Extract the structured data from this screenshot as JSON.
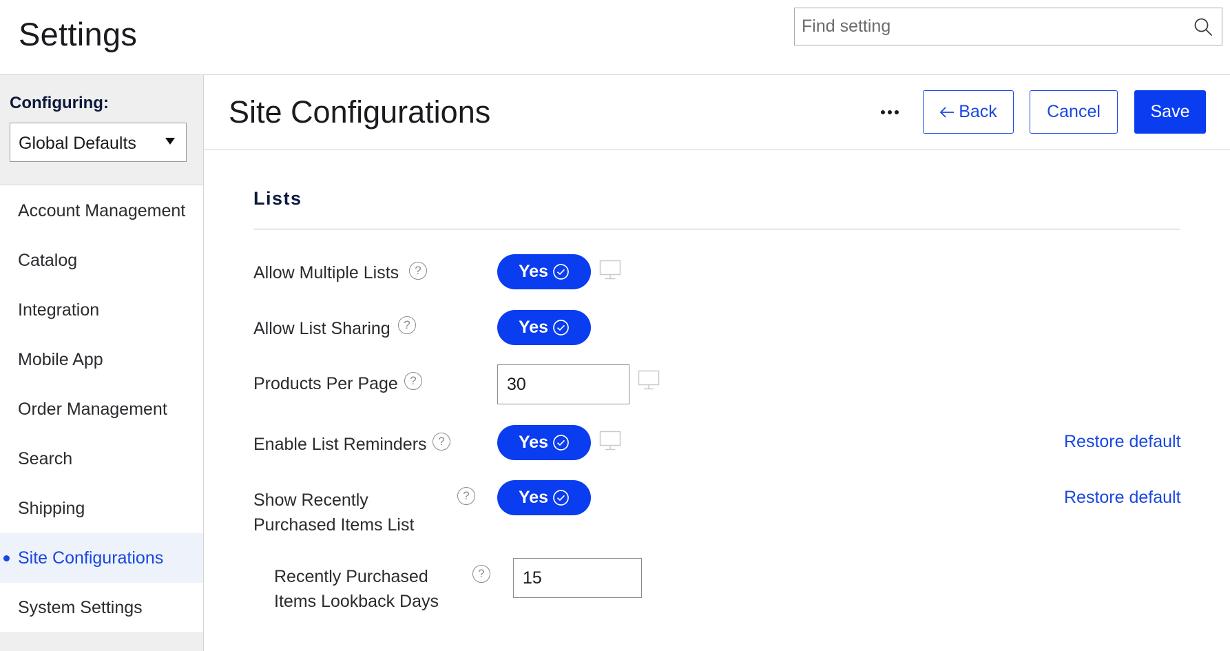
{
  "header": {
    "title": "Settings",
    "search": {
      "placeholder": "Find setting",
      "value": ""
    }
  },
  "sidebar": {
    "configuring_label": "Configuring:",
    "configuring_value": "Global Defaults",
    "items": [
      {
        "label": "Account Management",
        "active": false
      },
      {
        "label": "Catalog",
        "active": false
      },
      {
        "label": "Integration",
        "active": false
      },
      {
        "label": "Mobile App",
        "active": false
      },
      {
        "label": "Order Management",
        "active": false
      },
      {
        "label": "Search",
        "active": false
      },
      {
        "label": "Shipping",
        "active": false
      },
      {
        "label": "Site Configurations",
        "active": true
      },
      {
        "label": "System Settings",
        "active": false
      }
    ]
  },
  "page": {
    "title": "Site Configurations",
    "back_label": "Back",
    "cancel_label": "Cancel",
    "save_label": "Save"
  },
  "section": {
    "title": "Lists",
    "settings": [
      {
        "label": "Allow Multiple Lists",
        "type": "toggle",
        "value": "Yes",
        "device_icon": true
      },
      {
        "label": "Allow List Sharing",
        "type": "toggle",
        "value": "Yes",
        "device_icon": false
      },
      {
        "label": "Products Per Page",
        "type": "number",
        "value": "30",
        "device_icon": true
      },
      {
        "label": "Enable List Reminders",
        "type": "toggle",
        "value": "Yes",
        "device_icon": true,
        "restore_label": "Restore default"
      },
      {
        "label_line1": "Show Recently",
        "label_line2": "Purchased Items List",
        "type": "toggle",
        "value": "Yes",
        "device_icon": false,
        "restore_label": "Restore default"
      },
      {
        "label_line1": "Recently Purchased",
        "label_line2": "Items Lookback Days",
        "type": "number",
        "value": "15",
        "device_icon": false
      }
    ]
  },
  "colors": {
    "accent": "#0a3cf0",
    "link": "#1947e0",
    "sidebar_bg": "#efefef",
    "active_bg": "#eef2fb"
  }
}
